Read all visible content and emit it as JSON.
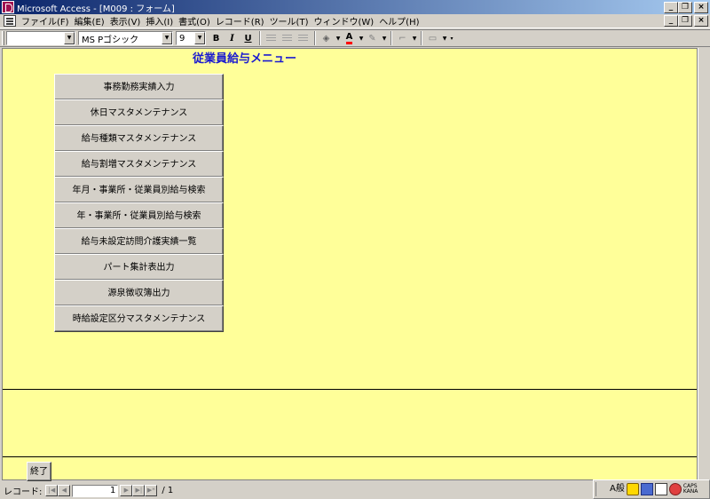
{
  "window": {
    "title": "Microsoft Access - [M009 : フォーム]",
    "buttons": {
      "minimize": "_",
      "restore": "❐",
      "close": "×"
    }
  },
  "menubar": {
    "items": [
      {
        "label": "ファイル(F)"
      },
      {
        "label": "編集(E)"
      },
      {
        "label": "表示(V)"
      },
      {
        "label": "挿入(I)"
      },
      {
        "label": "書式(O)"
      },
      {
        "label": "レコード(R)"
      },
      {
        "label": "ツール(T)"
      },
      {
        "label": "ウィンドウ(W)"
      },
      {
        "label": "ヘルプ(H)"
      }
    ]
  },
  "toolbar": {
    "object_combo": "",
    "font_name": "MS Pゴシック",
    "font_size": "9",
    "bold": "B",
    "italic": "I",
    "underline": "U",
    "font_color_label": "A",
    "accent_color": "#ff0000"
  },
  "form": {
    "title": "従業員給与メニュー",
    "background": "#ffff99",
    "title_color": "#1a1ad0",
    "buttons": [
      {
        "label": "事務勤務実績入力"
      },
      {
        "label": "休日マスタメンテナンス"
      },
      {
        "label": "給与種類マスタメンテナンス"
      },
      {
        "label": "給与割増マスタメンテナンス"
      },
      {
        "label": "年月・事業所・従業員別給与検索"
      },
      {
        "label": "年・事業所・従業員別給与検索"
      },
      {
        "label": "給与未設定訪問介護実績一覧"
      },
      {
        "label": "パート集計表出力"
      },
      {
        "label": "源泉徴収簿出力"
      },
      {
        "label": "時給設定区分マスタメンテナンス"
      }
    ],
    "exit_label": "終了"
  },
  "navigation": {
    "label": "レコード:",
    "current": "1",
    "total": "/ 1",
    "first": "|◀",
    "prev": "◀",
    "next": "▶",
    "last": "▶|",
    "new": "▶*"
  },
  "ime": {
    "mode_label": "A般",
    "caps": "CAPS",
    "kana": "KANA"
  }
}
